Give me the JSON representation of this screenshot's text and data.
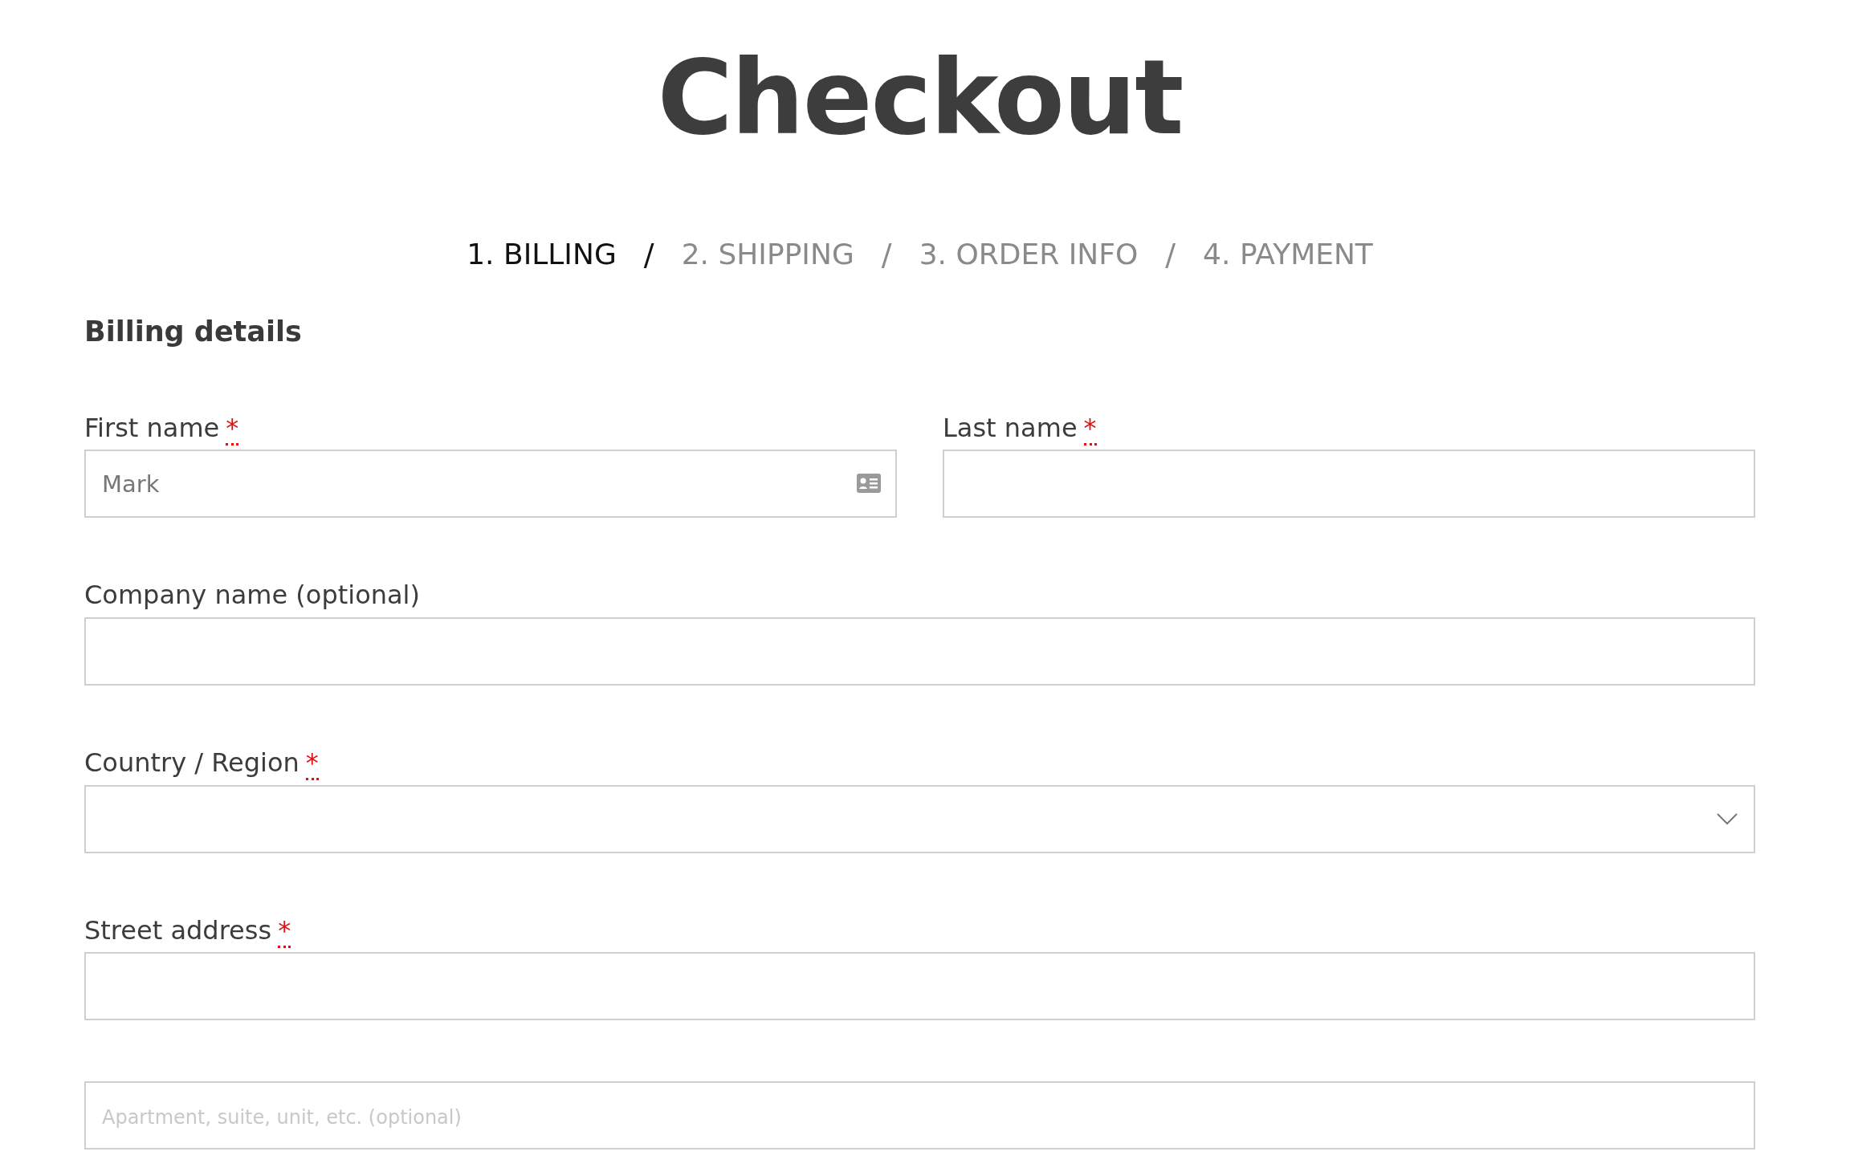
{
  "title": "Checkout",
  "steps": [
    {
      "label": "1. BILLING",
      "selected": true
    },
    {
      "label": "2. SHIPPING",
      "selected": false
    },
    {
      "label": "3. ORDER INFO",
      "selected": false
    },
    {
      "label": "4. PAYMENT",
      "selected": false
    }
  ],
  "step_separator": "/",
  "section_title": "Billing details",
  "rows": [
    {
      "fields": [
        {
          "kind": "text",
          "label": "First name",
          "required_mark": "*",
          "value": "Mark",
          "autofill_icon": true
        },
        {
          "kind": "text",
          "label": "Last name",
          "required_mark": "*"
        }
      ]
    },
    {
      "fields": [
        {
          "kind": "text",
          "label": "Company name (optional)"
        }
      ]
    },
    {
      "fields": [
        {
          "kind": "select",
          "label": "Country / Region",
          "required_mark": "*"
        }
      ]
    },
    {
      "fields": [
        {
          "kind": "text",
          "label": "Street address",
          "required_mark": "*"
        }
      ]
    },
    {
      "fields": [
        {
          "kind": "text",
          "placeholder": "Apartment, suite, unit, etc. (optional)"
        }
      ]
    }
  ]
}
